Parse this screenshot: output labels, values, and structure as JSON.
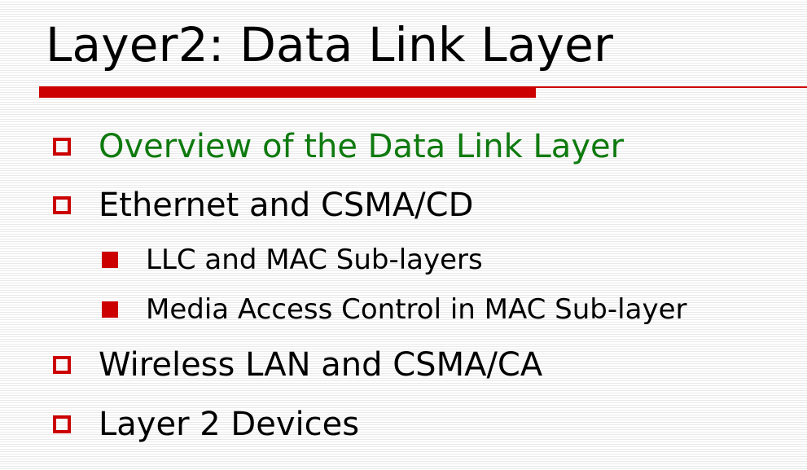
{
  "slide": {
    "title": "Layer2: Data Link Layer",
    "accent_color": "#cc0000",
    "highlight_color": "#0f7a0f",
    "bullets": [
      {
        "text": "Overview of the Data Link Layer",
        "level": 1,
        "highlighted": true
      },
      {
        "text": "Ethernet and CSMA/CD",
        "level": 1,
        "highlighted": false
      },
      {
        "text": "LLC and MAC Sub-layers",
        "level": 2,
        "highlighted": false
      },
      {
        "text": "Media Access Control in MAC Sub-layer",
        "level": 2,
        "highlighted": false
      },
      {
        "text": "Wireless LAN and CSMA/CA",
        "level": 1,
        "highlighted": false
      },
      {
        "text": "Layer 2 Devices",
        "level": 1,
        "highlighted": false
      }
    ]
  }
}
